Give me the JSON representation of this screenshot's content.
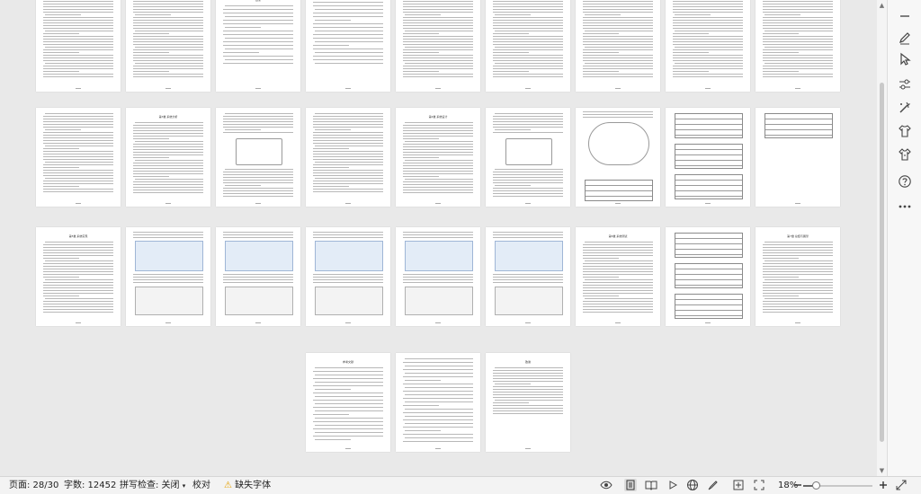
{
  "status_bar": {
    "page_label": "页面: 28/30",
    "word_count": "字数: 12452",
    "spellcheck_label": "拼写检查: 关闭",
    "proofread_label": "校对",
    "missing_font_label": "缺失字体",
    "zoom_label": "18%",
    "zoom_fraction": 0.18
  },
  "pages": {
    "toc_title": "目录",
    "ch3_title": "第3章 系统分析",
    "ch4_title": "第4章 系统设计",
    "ch5_title": "第5章 系统实现",
    "ch6_title": "第6章 系统测试",
    "ch7_title": "第7章 总结与展望",
    "refs_title": "参考文献",
    "thanks_title": "致谢"
  },
  "toolbar_icons": [
    "minus-icon",
    "pen-icon",
    "pointer-icon",
    "sliders-icon",
    "magic-tools-icon",
    "shirt-icon",
    "shirt-outline-icon",
    "help-icon",
    "more-icon"
  ],
  "status_icons": [
    "eye-icon",
    "page-view-icon",
    "book-icon",
    "play-icon",
    "globe-icon",
    "brush-icon",
    "fit-page-icon",
    "fullscreen-icon",
    "zoom-out-icon",
    "zoom-in-icon",
    "expand-icon"
  ]
}
